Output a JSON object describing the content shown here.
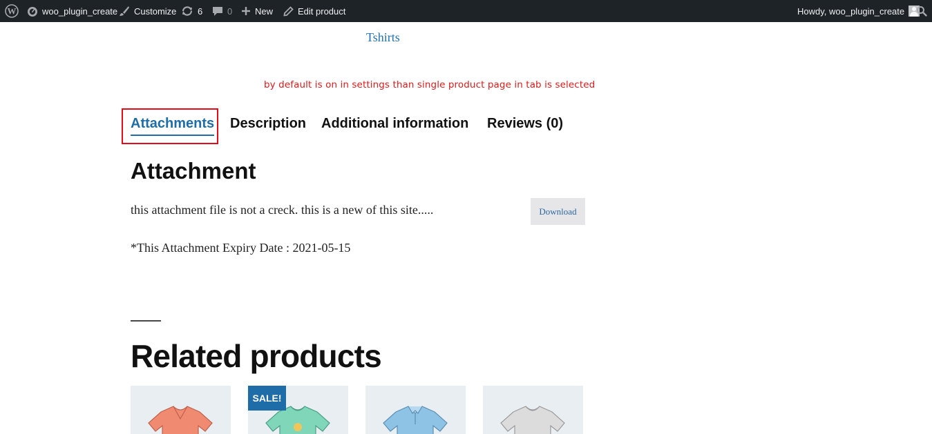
{
  "admin_bar": {
    "site_name": "woo_plugin_create",
    "customize": "Customize",
    "updates_count": "6",
    "comments_count": "0",
    "new": "New",
    "edit_product": "Edit product",
    "howdy": "Howdy, woo_plugin_create"
  },
  "site_title": "Tshirts",
  "note": "by default is on in settings than single product page in tab is selected",
  "tabs": [
    {
      "label": "Attachments",
      "active": true
    },
    {
      "label": "Description",
      "active": false
    },
    {
      "label": "Additional information",
      "active": false
    },
    {
      "label": "Reviews (0)",
      "active": false
    }
  ],
  "attachment": {
    "heading": "Attachment",
    "description": "this attachment file is not a creck. this is a new of this site.....",
    "download_label": "Download",
    "expiry": "*This Attachment Expiry Date : 2021-05-15"
  },
  "related": {
    "title": "Related products",
    "sale_badge": "SALE!",
    "products": [
      {
        "icon": "tshirt-icon",
        "color": "#f08b72"
      },
      {
        "icon": "tshirt-icon",
        "color": "#7fd6b9"
      },
      {
        "icon": "polo-shirt-icon",
        "color": "#8fc3e6"
      },
      {
        "icon": "tshirt-icon",
        "color": "#dcdcdc"
      }
    ]
  },
  "colors": {
    "admin_bar_bg": "#1d2327",
    "link_blue": "#2271b1",
    "tab_active": "#1e6da8",
    "note_red": "#e0191a",
    "highlight_red": "#e30b17"
  }
}
